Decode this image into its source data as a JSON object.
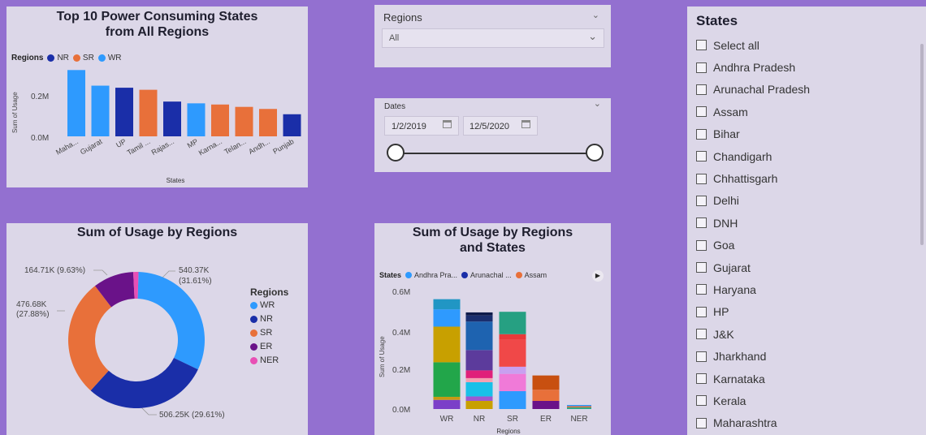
{
  "colors": {
    "WR": "#2e9afe",
    "NR": "#1a2ea8",
    "SR": "#e8703a",
    "ER": "#6a1289",
    "NER": "#e84fb5"
  },
  "top10": {
    "title_line1": "Top 10 Power Consuming States",
    "title_line2": "from All Regions",
    "legend_label": "Regions",
    "legend": [
      {
        "name": "NR",
        "color": "#1a2ea8"
      },
      {
        "name": "SR",
        "color": "#e8703a"
      },
      {
        "name": "WR",
        "color": "#2e9afe"
      }
    ],
    "ylabel": "Sum of Usage",
    "xlabel": "States",
    "yticks": [
      "0.2M",
      "0.0M"
    ]
  },
  "region_filter": {
    "label": "Regions",
    "value": "All"
  },
  "date_filter": {
    "label": "Dates",
    "start": "1/2/2019",
    "end": "12/5/2020"
  },
  "donut": {
    "title": "Sum of Usage by Regions",
    "legend_title": "Regions",
    "labels": {
      "WR": "540.37K",
      "WR_pct": "(31.61%)",
      "NR": "506.25K (29.61%)",
      "SR": "476.68K",
      "SR_pct": "(27.88%)",
      "ER": "164.71K (9.63%)"
    },
    "legend": [
      {
        "name": "WR",
        "color": "#2e9afe"
      },
      {
        "name": "NR",
        "color": "#1a2ea8"
      },
      {
        "name": "SR",
        "color": "#e8703a"
      },
      {
        "name": "ER",
        "color": "#6a1289"
      },
      {
        "name": "NER",
        "color": "#e84fb5"
      }
    ]
  },
  "stacked": {
    "title_line1": "Sum of Usage by Regions",
    "title_line2": "and States",
    "legend_label": "States",
    "legend": [
      {
        "name": "Andhra Pra...",
        "color": "#2e9afe"
      },
      {
        "name": "Arunachal ...",
        "color": "#1a2ea8"
      },
      {
        "name": "Assam",
        "color": "#e8703a"
      }
    ],
    "ylabel": "Sum of Usage",
    "xlabel": "Regions",
    "yticks": [
      "0.6M",
      "0.4M",
      "0.2M",
      "0.0M"
    ]
  },
  "states_slicer": {
    "title": "States",
    "items": [
      "Select all",
      "Andhra Pradesh",
      "Arunachal Pradesh",
      "Assam",
      "Bihar",
      "Chandigarh",
      "Chhattisgarh",
      "Delhi",
      "DNH",
      "Goa",
      "Gujarat",
      "Haryana",
      "HP",
      "J&K",
      "Jharkhand",
      "Karnataka",
      "Kerala",
      "Maharashtra"
    ]
  },
  "chart_data": [
    {
      "type": "bar",
      "title": "Top 10 Power Consuming States from All Regions",
      "xlabel": "States",
      "ylabel": "Sum of Usage",
      "categories": [
        "Maha...",
        "Gujarat",
        "UP",
        "Tamil ...",
        "Rajas...",
        "MP",
        "Karna...",
        "Telan...",
        "Andh...",
        "Punjab"
      ],
      "values": [
        225000,
        172000,
        165000,
        158000,
        118000,
        112000,
        108000,
        100000,
        93000,
        75000
      ],
      "region": [
        "WR",
        "WR",
        "NR",
        "SR",
        "NR",
        "WR",
        "SR",
        "SR",
        "SR",
        "NR"
      ],
      "ylim": [
        0,
        290000
      ]
    },
    {
      "type": "pie",
      "title": "Sum of Usage by Regions",
      "categories": [
        "WR",
        "NR",
        "SR",
        "ER",
        "NER"
      ],
      "values": [
        540370,
        506250,
        476680,
        164710,
        21000
      ]
    },
    {
      "type": "bar",
      "stacked": true,
      "title": "Sum of Usage by Regions and States",
      "xlabel": "Regions",
      "ylabel": "Sum of Usage",
      "categories": [
        "WR",
        "NR",
        "SR",
        "ER",
        "NER"
      ],
      "ylim": [
        0,
        620000
      ],
      "stacks": [
        [
          {
            "v": 45000,
            "c": "#7b3fc8"
          },
          {
            "v": 15000,
            "c": "#c79a12"
          },
          {
            "v": 170000,
            "c": "#22a64a"
          },
          {
            "v": 175000,
            "c": "#c8a000"
          },
          {
            "v": 85000,
            "c": "#2e9afe"
          },
          {
            "v": 50000,
            "c": "#2196c4"
          }
        ],
        [
          {
            "v": 40000,
            "c": "#c8a000"
          },
          {
            "v": 22000,
            "c": "#9b59d0"
          },
          {
            "v": 70000,
            "c": "#18c0e8"
          },
          {
            "v": 20000,
            "c": "#f5a0b0"
          },
          {
            "v": 38000,
            "c": "#e0207a"
          },
          {
            "v": 100000,
            "c": "#5c3b9c"
          },
          {
            "v": 140000,
            "c": "#1e63b0"
          },
          {
            "v": 30000,
            "c": "#1a2e6e"
          },
          {
            "v": 15000,
            "c": "#0e1a4a"
          }
        ],
        [
          {
            "v": 88000,
            "c": "#2e9afe"
          },
          {
            "v": 85000,
            "c": "#f07ad8"
          },
          {
            "v": 35000,
            "c": "#c8a0f0"
          },
          {
            "v": 135000,
            "c": "#f04848"
          },
          {
            "v": 25000,
            "c": "#e83a3a"
          },
          {
            "v": 110000,
            "c": "#26a082"
          }
        ],
        [
          {
            "v": 40000,
            "c": "#6a1289"
          },
          {
            "v": 55000,
            "c": "#e8703a"
          },
          {
            "v": 70000,
            "c": "#c85010"
          }
        ],
        [
          {
            "v": 8000,
            "c": "#2ea888"
          },
          {
            "v": 6000,
            "c": "#e8703a"
          },
          {
            "v": 6000,
            "c": "#2e9afe"
          }
        ]
      ]
    }
  ]
}
